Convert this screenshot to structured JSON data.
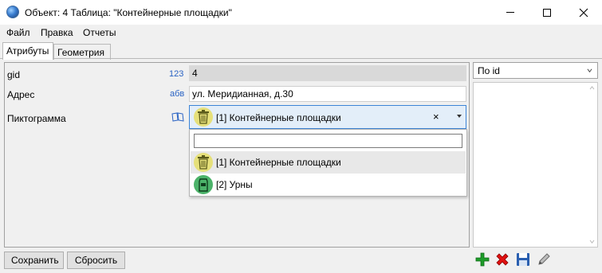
{
  "window": {
    "title": "Объект: 4 Таблица: \"Контейнерные площадки\""
  },
  "menu": [
    "Файл",
    "Правка",
    "Отчеты"
  ],
  "tabs": [
    "Атрибуты",
    "Геометрия"
  ],
  "attributes": {
    "gid": {
      "label": "gid",
      "type_icon": "123",
      "value": "4"
    },
    "address": {
      "label": "Адрес",
      "type_icon": "абв",
      "value": "ул. Меридианная, д.30"
    },
    "pictogram": {
      "label": "Пиктограмма",
      "type_icon": "dictionary-icon",
      "value": "[1] Контейнерные площадки",
      "clear": "×"
    }
  },
  "dropdown": {
    "search_value": "",
    "options": [
      {
        "label": "[1] Контейнерные площадки",
        "icon": "trash-bin-icon",
        "icon_bg": "#e6e07a",
        "highlighted": true
      },
      {
        "label": "[2] Урны",
        "icon": "urn-icon",
        "icon_bg": "#4cb36a",
        "highlighted": false
      }
    ]
  },
  "sort": {
    "selected": "По id"
  },
  "buttons": {
    "save": "Сохранить",
    "reset": "Сбросить"
  },
  "toolbar": [
    "add-icon",
    "delete-icon",
    "save-icon",
    "edit-icon"
  ],
  "colors": {
    "combo_border": "#3c84d6",
    "combo_bg": "#e3eef9",
    "add": "#1e9c2a",
    "delete": "#e01010",
    "save": "#2a5fb0"
  }
}
